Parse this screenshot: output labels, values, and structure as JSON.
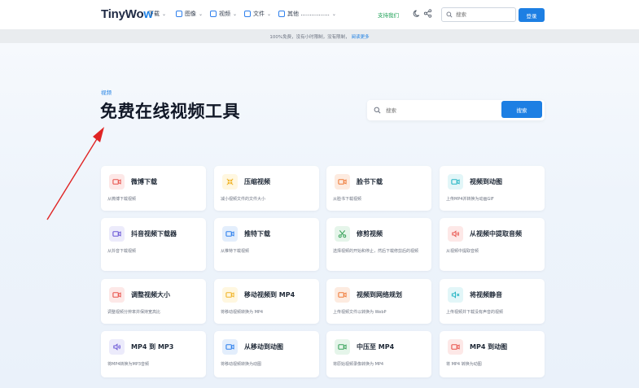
{
  "header": {
    "logo_main": "TinyWo",
    "logo_accent": "w",
    "nav": [
      {
        "label": "下载"
      },
      {
        "label": "图像"
      },
      {
        "label": "视频"
      },
      {
        "label": "文件"
      },
      {
        "label": "其他 ................"
      }
    ],
    "support_label": "支持我们",
    "search_placeholder": "搜索",
    "login_label": "登录"
  },
  "announcement": {
    "text": "100%免费，没有小时限制，没有限制，",
    "link": "阅读更多"
  },
  "hero": {
    "breadcrumb": "视频",
    "title": "免费在线视频工具",
    "search_placeholder": "搜索",
    "search_button": "搜索"
  },
  "tools": [
    {
      "title": "微博下载",
      "desc": "从微博下载视频",
      "icon": "video-icon",
      "color": "#e8534c",
      "bg": "#fde8e7"
    },
    {
      "title": "压缩视频",
      "desc": "减小视频文件的文件大小",
      "icon": "compress-icon",
      "color": "#f0b429",
      "bg": "#fff7e0"
    },
    {
      "title": "脸书下载",
      "desc": "从脸书下载视频",
      "icon": "video-icon",
      "color": "#ef7d3c",
      "bg": "#fdebe0"
    },
    {
      "title": "视频到动图",
      "desc": "上传MP4并转换为动画GIF",
      "icon": "video-icon",
      "color": "#26b5c4",
      "bg": "#e2f6f8"
    },
    {
      "title": "抖音视频下载器",
      "desc": "从抖音下载视频",
      "icon": "video-icon",
      "color": "#6b57d6",
      "bg": "#ecebfb"
    },
    {
      "title": "推特下载",
      "desc": "从推特下载视频",
      "icon": "video-icon",
      "color": "#2f80ed",
      "bg": "#e3eefc"
    },
    {
      "title": "修剪视频",
      "desc": "选择视频的开始和停止，然后下载修剪后的视频",
      "icon": "scissors-icon",
      "color": "#3aa35c",
      "bg": "#e5f5ea"
    },
    {
      "title": "从视频中提取音频",
      "desc": "从视频中提取音频",
      "icon": "audio-icon",
      "color": "#e8534c",
      "bg": "#fde8e7"
    },
    {
      "title": "调整视频大小",
      "desc": "调整视频分辨率并保持宽高比",
      "icon": "video-icon",
      "color": "#e8534c",
      "bg": "#fde8e7"
    },
    {
      "title": "移动视频到 MP4",
      "desc": "将移动视频转换为 MP4",
      "icon": "video-icon",
      "color": "#f0b429",
      "bg": "#fff7e0"
    },
    {
      "title": "视频到网络规划",
      "desc": "上传视频文件以转换为 WebP",
      "icon": "video-icon",
      "color": "#ef7d3c",
      "bg": "#fdebe0"
    },
    {
      "title": "将视频静音",
      "desc": "上传视频并下载没有声音的视频",
      "icon": "mute-icon",
      "color": "#26b5c4",
      "bg": "#e2f6f8"
    },
    {
      "title": "MP4 到 MP3",
      "desc": "将MP4转换为MP3音频",
      "icon": "audio-icon",
      "color": "#6b57d6",
      "bg": "#ecebfb"
    },
    {
      "title": "从移动到动图",
      "desc": "将移动视频转换为动图",
      "icon": "video-icon",
      "color": "#2f80ed",
      "bg": "#e3eefc"
    },
    {
      "title": "中压至 MP4",
      "desc": "将原始视频录像转换为 MP4",
      "icon": "video-icon",
      "color": "#3aa35c",
      "bg": "#e5f5ea"
    },
    {
      "title": "MP4 到动图",
      "desc": "将 MP4 转换为动图",
      "icon": "video-icon",
      "color": "#e8534c",
      "bg": "#fde8e7"
    }
  ]
}
